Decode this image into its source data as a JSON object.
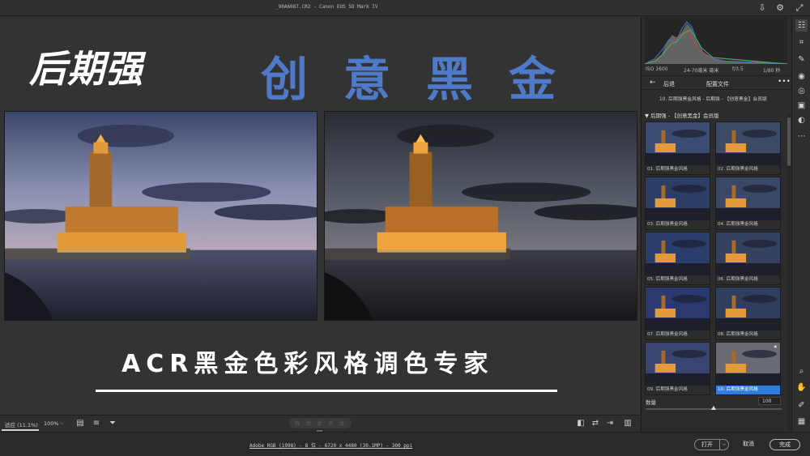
{
  "window": {
    "file_title": "_90A6087.CR2  -  Canon EOS 5D Mark IV"
  },
  "canvas": {
    "brand": "后期强",
    "tagline": "创意黑金",
    "headline": "ACR黑金色彩风格调色专家"
  },
  "bottom_toolbar": {
    "fit_label": "适应 (11.1%)",
    "zoom_label": "100%",
    "zoom_caret": "⌵",
    "rating_stars": "☆ ☆ ☆ ☆ ☆ 🗑"
  },
  "status": {
    "info": "Adobe RGB (1998) - 8 位 - 6720 x 4480 (30.1MP) - 300 ppi",
    "open_button": "打开",
    "open_caret": "⌵",
    "cancel_button": "取消",
    "done_button": "完成"
  },
  "panel": {
    "camera_info": {
      "iso": "ISO 1600",
      "focal": "24-70毫米 毫米",
      "aperture": "f/3.5",
      "shutter": "1/80 秒"
    },
    "back_label": "后退",
    "title": "配置文件",
    "more": "•••",
    "breadcrumb": "10. 后期强黑金风格 - 后期强 - 【创意黑金】会员版",
    "group_label": "▼  后期强 - 【创意黑金】会员版",
    "presets": [
      {
        "label": "01. 后期强黑金风格"
      },
      {
        "label": "02. 后期强黑金风格"
      },
      {
        "label": "03. 后期强黑金风格"
      },
      {
        "label": "04. 后期强黑金风格"
      },
      {
        "label": "05. 后期强黑金风格"
      },
      {
        "label": "06. 后期强黑金风格"
      },
      {
        "label": "07. 后期强黑金风格"
      },
      {
        "label": "08. 后期强黑金风格"
      },
      {
        "label": "09. 后期强黑金风格"
      },
      {
        "label": "10. 后期强黑金风格"
      }
    ],
    "selected_preset": 10,
    "amount_label": "数量",
    "amount_value": "100",
    "amount_fraction": 0.5
  },
  "icons": {
    "top_right": [
      "export-icon",
      "gear-icon",
      "expand-icon"
    ],
    "rail": [
      "edit-icon",
      "crop-icon",
      "brush-icon",
      "redeye-icon",
      "eye-icon",
      "snapshot-icon",
      "presets-icon",
      "more-icon",
      "zoom-icon",
      "hand-icon",
      "eyedropper-icon",
      "grid-icon"
    ]
  },
  "colors": {
    "accent_blue": "#4f79c9",
    "selection_blue": "#2f7de0"
  }
}
